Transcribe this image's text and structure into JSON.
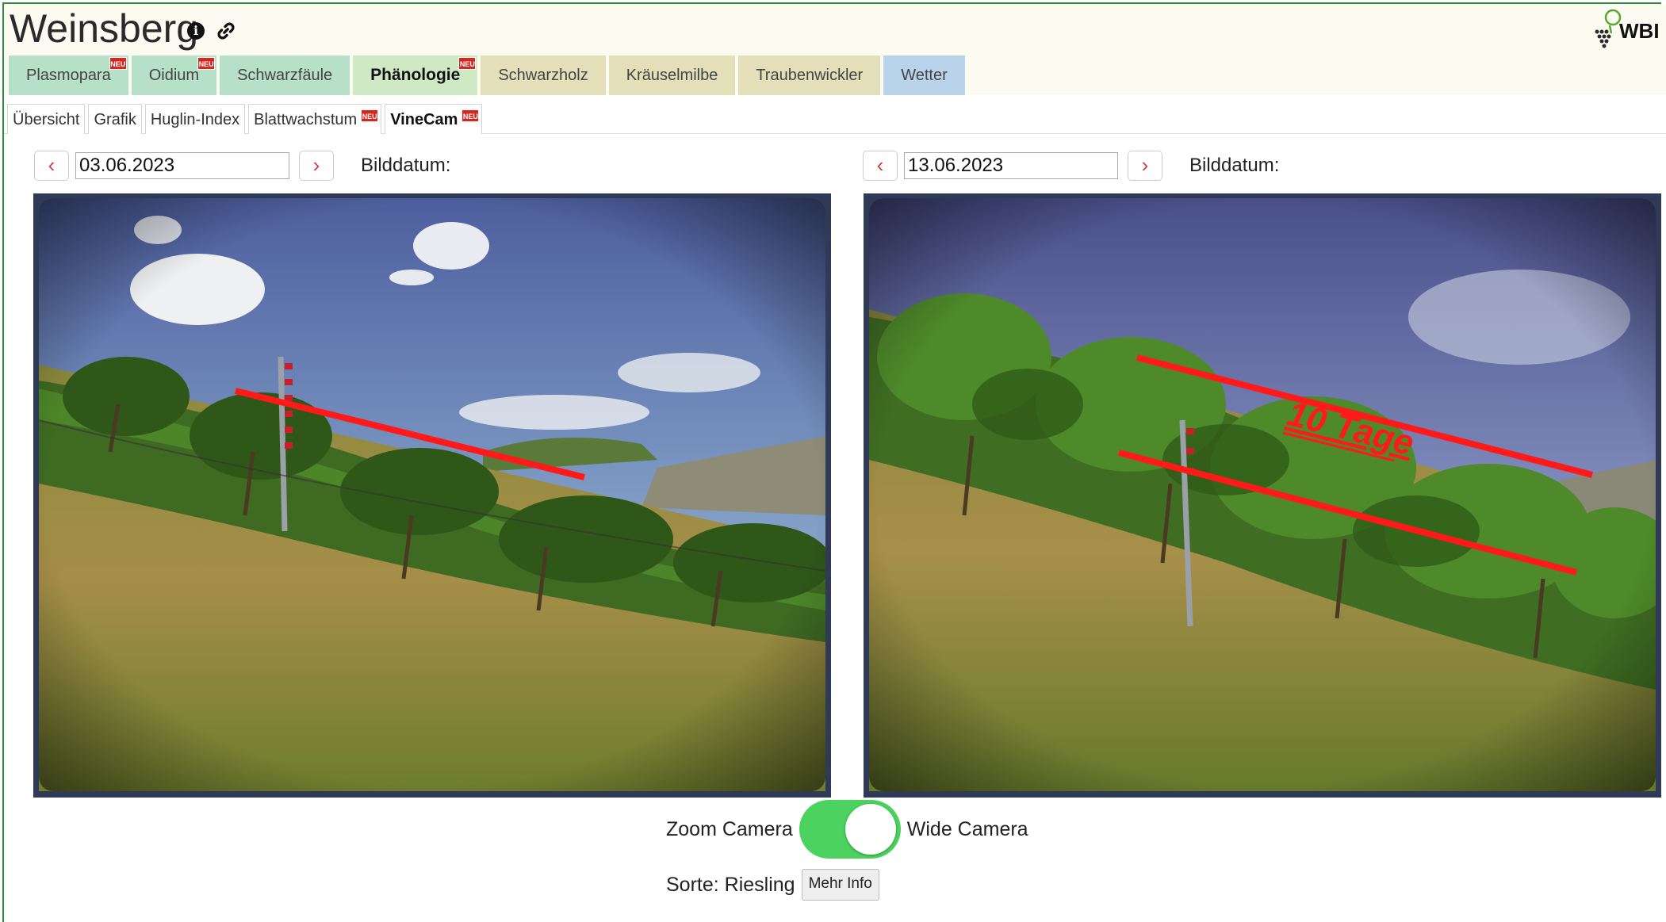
{
  "header": {
    "title": "Weinsberg",
    "info_icon": "info-icon",
    "link_icon": "link-icon",
    "logo_text": "WBI"
  },
  "main_tabs": [
    {
      "label": "Plasmopara",
      "neu": true,
      "color": "#b7e0c8"
    },
    {
      "label": "Oidium",
      "neu": true,
      "color": "#b7e0c8"
    },
    {
      "label": "Schwarzfäule",
      "neu": false,
      "color": "#b7e0c8"
    },
    {
      "label": "Phänologie",
      "neu": true,
      "active": true,
      "color": "#cfe9c4"
    },
    {
      "label": "Schwarzholz",
      "neu": false,
      "color": "#e2dfb9"
    },
    {
      "label": "Kräuselmilbe",
      "neu": false,
      "color": "#e2dfb9"
    },
    {
      "label": "Traubenwickler",
      "neu": false,
      "color": "#e2dfb9"
    },
    {
      "label": "Wetter",
      "neu": false,
      "color": "#b8d3ea"
    }
  ],
  "neu_badge": "NEU",
  "sub_tabs": [
    {
      "label": "Übersicht"
    },
    {
      "label": "Grafik"
    },
    {
      "label": "Huglin-Index"
    },
    {
      "label": "Blattwachstum",
      "neu": true
    },
    {
      "label": "VineCam",
      "neu": true,
      "active": true
    }
  ],
  "left_viewer": {
    "date": "03.06.2023",
    "label": "Bilddatum:"
  },
  "right_viewer": {
    "date": "13.06.2023",
    "label": "Bilddatum:",
    "annotation": "10 Tage"
  },
  "camera_toggle": {
    "left_label": "Zoom Camera",
    "right_label": "Wide Camera",
    "state": "wide"
  },
  "variety": {
    "text": "Sorte: Riesling",
    "button": "Mehr Info"
  },
  "colors": {
    "frame": "#2e8b3a",
    "toggle_on": "#4cd25f",
    "annotation_red": "#ff1a1a"
  }
}
